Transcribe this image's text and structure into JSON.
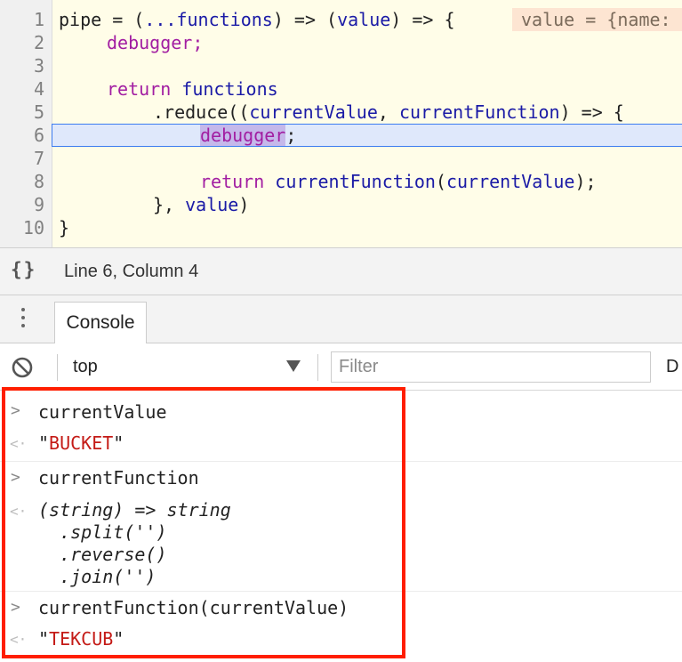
{
  "editor": {
    "line_numbers": [
      "1",
      "2",
      "3",
      "4",
      "5",
      "6",
      "7",
      "8",
      "9",
      "10"
    ],
    "lines": {
      "l1_a": "pipe = (",
      "l1_b": "...functions",
      "l1_c": ") => (",
      "l1_d": "value",
      "l1_e": ") => {",
      "l2": "debugger;",
      "l4_a": "return ",
      "l4_b": "functions",
      "l5_a": ".reduce((",
      "l5_b": "currentValue",
      "l5_c": ", ",
      "l5_d": "currentFunction",
      "l5_e": ") => {",
      "l6_a": "debugger",
      "l6_b": ";",
      "l8_a": "return ",
      "l8_b": "currentFunction",
      "l8_c": "(",
      "l8_d": "currentValue",
      "l8_e": ");",
      "l9_a": "}, ",
      "l9_b": "value",
      "l9_c": ")",
      "l10": "}"
    },
    "inline_value": "value = {name:"
  },
  "statusbar": {
    "braces": "{}",
    "position": "Line 6, Column 4"
  },
  "drawer": {
    "console_tab": "Console"
  },
  "toolbar": {
    "context": "top",
    "filter_placeholder": "Filter",
    "levels": "D"
  },
  "console": {
    "prompt_symbol": ">",
    "result_symbol": "<·",
    "entries": [
      {
        "input": "currentValue",
        "quote_open": "\"",
        "output": "BUCKET",
        "quote_close": "\""
      },
      {
        "input": "currentFunction",
        "output_lines": [
          "(string) => string",
          "  .split('')",
          "  .reverse()",
          "  .join('')"
        ]
      },
      {
        "input": "currentFunction(currentValue)",
        "quote_open": "\"",
        "output": "TEKCUB",
        "quote_close": "\""
      }
    ]
  },
  "colors": {
    "keyword": "#a21ea2",
    "identifier": "#1a1aa6",
    "string": "#c41a16",
    "highlight_box": "#ff1e00"
  }
}
